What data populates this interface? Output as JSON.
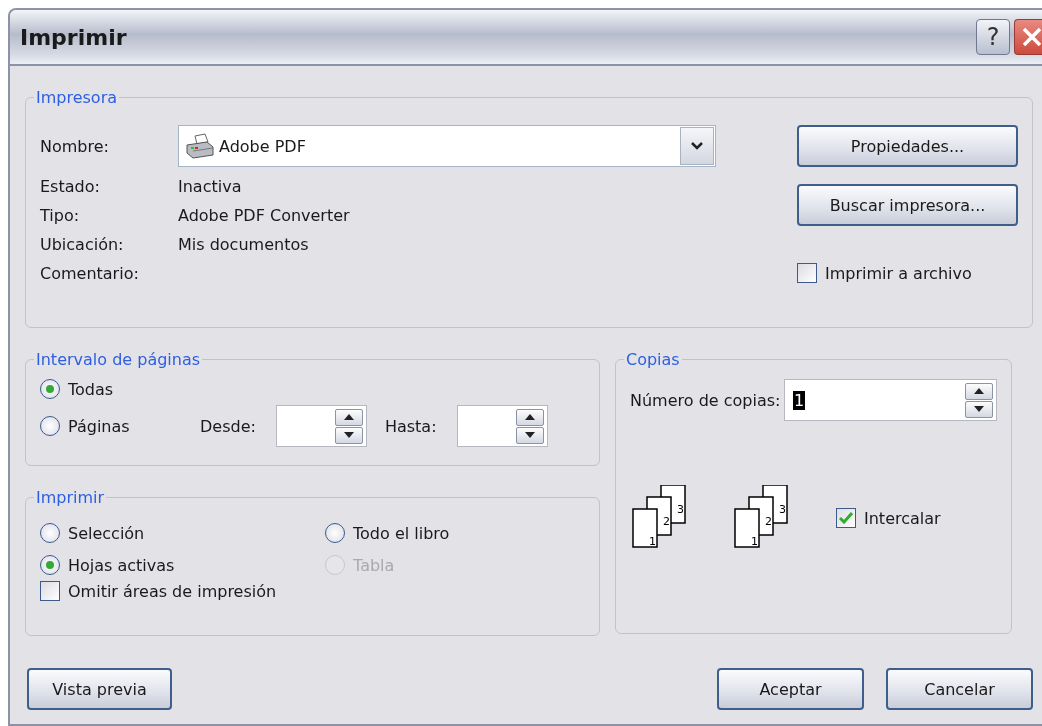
{
  "window": {
    "title": "Imprimir",
    "help": "?"
  },
  "printer": {
    "legend": "Impresora",
    "name_label": "Nombre:",
    "name_value": "Adobe PDF",
    "info": [
      {
        "label": "Estado:",
        "value": "Inactiva"
      },
      {
        "label": "Tipo:",
        "value": "Adobe PDF Converter"
      },
      {
        "label": "Ubicación:",
        "value": "Mis documentos"
      },
      {
        "label": "Comentario:"
      }
    ],
    "buttons": [
      "Propiedades...",
      "Buscar impresora..."
    ],
    "print_to_file": {
      "label": "Imprimir a archivo",
      "checked": false
    }
  },
  "page_range": {
    "legend": "Intervalo de páginas",
    "options": [
      {
        "label": "Todas",
        "selected": true
      },
      {
        "label": "Páginas",
        "selected": false
      }
    ],
    "from_label": "Desde:",
    "to_label": "Hasta:"
  },
  "print_what": {
    "legend": "Imprimir",
    "options": [
      {
        "label": "Selección",
        "selected": false,
        "disabled": false
      },
      {
        "label": "Todo el libro",
        "selected": false,
        "disabled": false
      },
      {
        "label": "Hojas activas",
        "selected": true,
        "disabled": false
      },
      {
        "label": "Tabla",
        "selected": false,
        "disabled": true
      }
    ],
    "ignore_areas": {
      "label": "Omitir áreas de impresión",
      "checked": false
    }
  },
  "copies": {
    "legend": "Copias",
    "count_label": "Número de copias:",
    "count_value": "1",
    "collate_icons": [
      [
        "1",
        "2",
        "3"
      ],
      [
        "1",
        "2",
        "3"
      ]
    ],
    "collate": {
      "label": "Intercalar",
      "checked": true
    }
  },
  "footer": {
    "preview": "Vista previa",
    "buttons": [
      "Aceptar",
      "Cancelar"
    ]
  }
}
